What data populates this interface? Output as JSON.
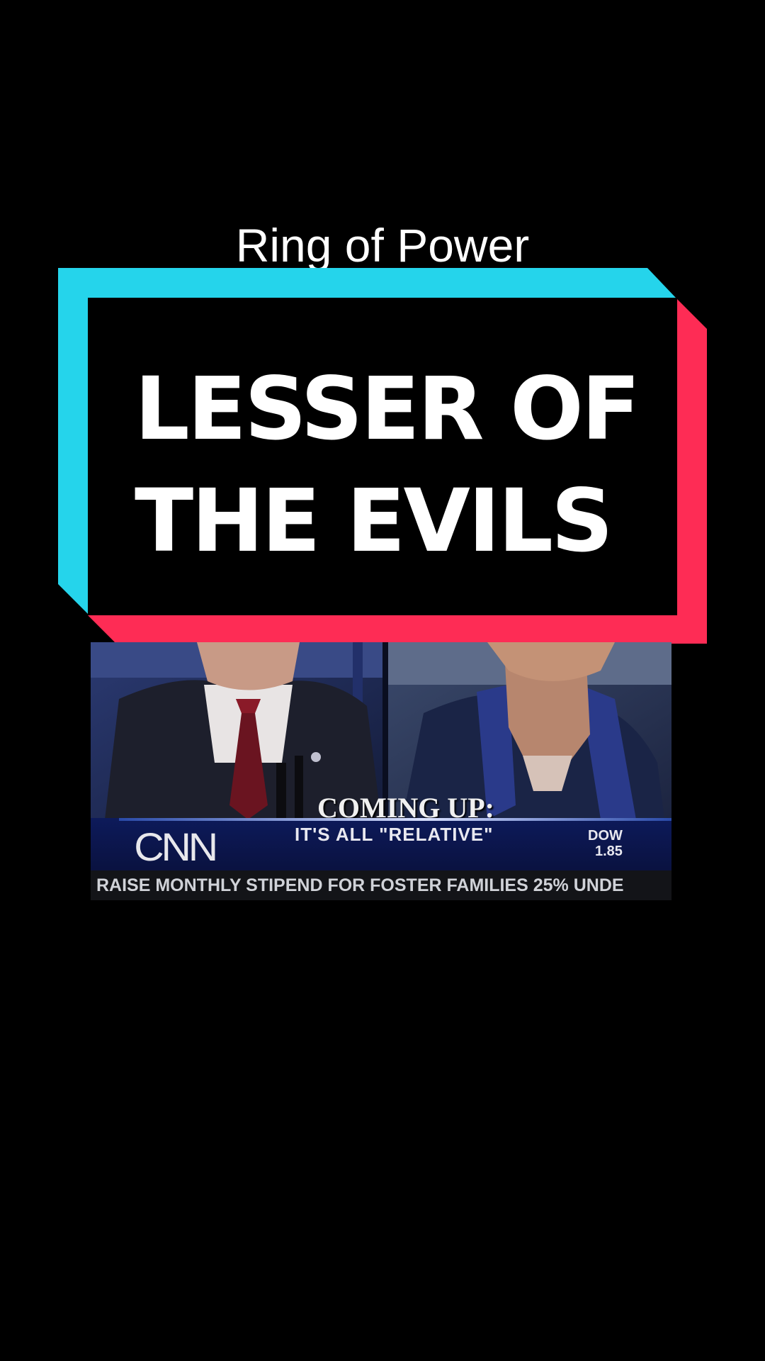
{
  "caption": "Ring of Power",
  "title": {
    "line1": "LESSER OF",
    "line2": "THE EVILS"
  },
  "colors": {
    "background": "#000000",
    "frame_cyan": "#25d4eb",
    "frame_red": "#fe2c55",
    "text": "#ffffff"
  },
  "video": {
    "coming_up": "COMING UP:",
    "network_logo": "CNN",
    "subline": "IT'S ALL \"RELATIVE\"",
    "dow_label": "DOW",
    "dow_value": "1.85",
    "ticker": "RAISE MONTHLY STIPEND FOR FOSTER FAMILIES 25% UNDE"
  }
}
